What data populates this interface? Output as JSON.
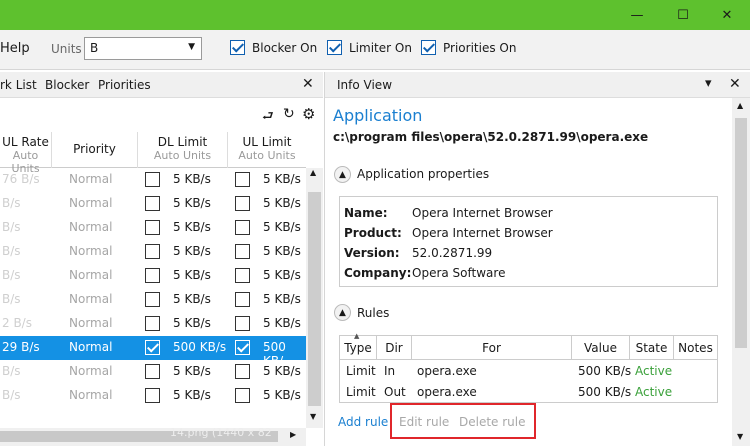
{
  "window": {
    "minimize": "—",
    "maximize": "☐",
    "close": "✕"
  },
  "toolbar": {
    "menu_help": "Help",
    "units_label": "Units",
    "units_value": "B",
    "blocker_on": "Blocker On",
    "limiter_on": "Limiter On",
    "priorities_on": "Priorities On",
    "blocker_checked": true,
    "limiter_checked": true,
    "priorities_checked": true
  },
  "left_panel": {
    "tabs": [
      "rk List",
      "Blocker",
      "Priorities"
    ],
    "close": "✕",
    "columns": {
      "ul_rate": "UL Rate",
      "ul_rate_sub": "Auto Units",
      "priority": "Priority",
      "dl_limit": "DL Limit",
      "dl_limit_sub": "Auto Units",
      "ul_limit": "UL Limit",
      "ul_limit_sub": "Auto Units"
    },
    "rows": [
      {
        "ul_rate": "76 B/s",
        "priority": "Normal",
        "dl": "5 KB/s",
        "ul": "5 KB/s"
      },
      {
        "ul_rate": "B/s",
        "priority": "Normal",
        "dl": "5 KB/s",
        "ul": "5 KB/s"
      },
      {
        "ul_rate": "B/s",
        "priority": "Normal",
        "dl": "5 KB/s",
        "ul": "5 KB/s"
      },
      {
        "ul_rate": "B/s",
        "priority": "Normal",
        "dl": "5 KB/s",
        "ul": "5 KB/s"
      },
      {
        "ul_rate": "B/s",
        "priority": "Normal",
        "dl": "5 KB/s",
        "ul": "5 KB/s"
      },
      {
        "ul_rate": "B/s",
        "priority": "Normal",
        "dl": "5 KB/s",
        "ul": "5 KB/s"
      },
      {
        "ul_rate": "2 B/s",
        "priority": "Normal",
        "dl": "5 KB/s",
        "ul": "5 KB/s"
      },
      {
        "ul_rate": "29 B/s",
        "priority": "Normal",
        "dl": "500 KB/s",
        "ul": "500 KB/"
      },
      {
        "ul_rate": "B/s",
        "priority": "Normal",
        "dl": "5 KB/s",
        "ul": "5 KB/s"
      },
      {
        "ul_rate": "B/s",
        "priority": "Normal",
        "dl": "5 KB/s",
        "ul": "5 KB/s"
      }
    ],
    "selected_row": 7,
    "footer_text": "14.png (1440 x 82"
  },
  "info_view": {
    "tab": "Info View",
    "dropdown": "▾",
    "close": "✕",
    "heading": "Application",
    "path": "c:\\program files\\opera\\52.0.2871.99\\opera.exe",
    "app_props_title": "Application properties",
    "props": [
      {
        "label": "Name:",
        "value": "Opera Internet Browser"
      },
      {
        "label": "Product:",
        "value": "Opera Internet Browser"
      },
      {
        "label": "Version:",
        "value": "52.0.2871.99"
      },
      {
        "label": "Company:",
        "value": "Opera Software"
      }
    ],
    "rules_title": "Rules",
    "rules_columns": {
      "type": "Type",
      "dir": "Dir",
      "for": "For",
      "value": "Value",
      "state": "State",
      "notes": "Notes"
    },
    "rules": [
      {
        "type": "Limit",
        "dir": "In",
        "for": "opera.exe",
        "value": "500 KB/s",
        "state": "Active"
      },
      {
        "type": "Limit",
        "dir": "Out",
        "for": "opera.exe",
        "value": "500 KB/s",
        "state": "Active"
      }
    ],
    "add_rule": "Add rule",
    "edit_rule": "Edit rule",
    "delete_rule": "Delete rule"
  },
  "colors": {
    "titlebar": "#5ec12e",
    "selection": "#1491e4",
    "link": "#1a7fd0",
    "active_state": "#3aa03a",
    "highlight_border": "#e0262b"
  }
}
